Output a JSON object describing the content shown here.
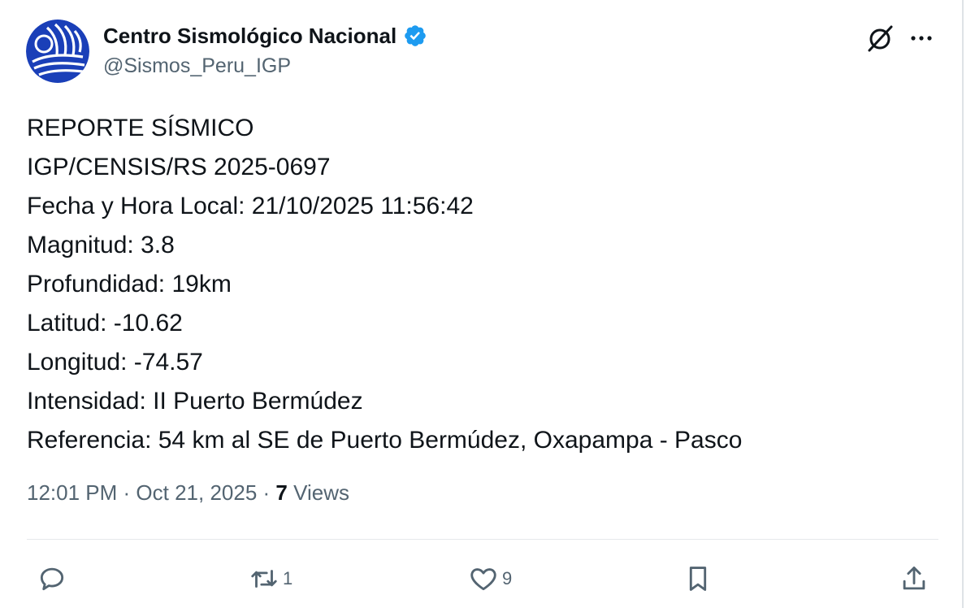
{
  "author": {
    "display_name": "Centro Sismológico Nacional",
    "handle": "@Sismos_Peru_IGP",
    "verified": true,
    "avatar_icon": "igp-logo-icon"
  },
  "header_actions": {
    "grok_icon": "grok-icon",
    "more_icon": "more-icon"
  },
  "tweet": {
    "lines": [
      "REPORTE SÍSMICO",
      "IGP/CENSIS/RS 2025-0697",
      "Fecha y Hora Local: 21/10/2025 11:56:42",
      "Magnitud: 3.8",
      "Profundidad: 19km",
      "Latitud: -10.62",
      "Longitud: -74.57",
      "Intensidad: II Puerto Bermúdez",
      "Referencia: 54 km al SE de Puerto Bermúdez, Oxapampa - Pasco"
    ]
  },
  "meta": {
    "time": "12:01 PM",
    "sep1": " · ",
    "date": "Oct 21, 2025",
    "sep2": " · ",
    "views_count": "7",
    "views_label": " Views"
  },
  "actions": {
    "reply": {
      "icon": "reply-icon",
      "count": ""
    },
    "retweet": {
      "icon": "retweet-icon",
      "count": "1"
    },
    "like": {
      "icon": "heart-icon",
      "count": "9"
    },
    "bookmark": {
      "icon": "bookmark-icon",
      "count": ""
    },
    "share": {
      "icon": "share-icon",
      "count": ""
    }
  },
  "colors": {
    "text": "#0f1419",
    "secondary": "#536471",
    "verified": "#1d9bf0",
    "avatar_blue": "#1a3fb8"
  }
}
